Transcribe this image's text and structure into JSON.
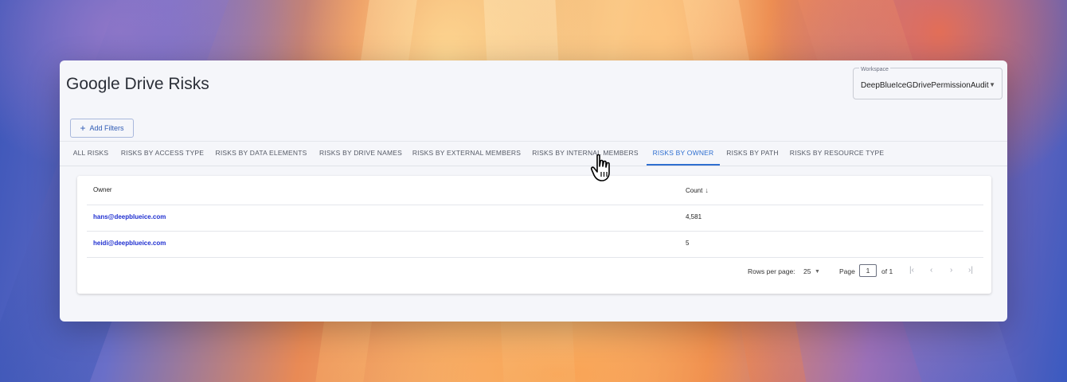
{
  "page": {
    "title": "Google Drive Risks"
  },
  "workspace": {
    "label": "Workspace",
    "value": "DeepBlueIceGDrivePermissionAudit"
  },
  "filters": {
    "add_label": "Add Filters"
  },
  "tabs": [
    {
      "label": "ALL RISKS",
      "active": false
    },
    {
      "label": "RISKS BY ACCESS TYPE",
      "active": false
    },
    {
      "label": "RISKS BY DATA ELEMENTS",
      "active": false
    },
    {
      "label": "RISKS BY DRIVE NAMES",
      "active": false
    },
    {
      "label": "RISKS BY EXTERNAL MEMBERS",
      "active": false
    },
    {
      "label": "RISKS BY INTERNAL MEMBERS",
      "active": false
    },
    {
      "label": "RISKS BY OWNER",
      "active": true
    },
    {
      "label": "RISKS BY PATH",
      "active": false
    },
    {
      "label": "RISKS BY RESOURCE TYPE",
      "active": false
    }
  ],
  "table": {
    "columns": [
      "Owner",
      "Count"
    ],
    "sort": {
      "column": "Count",
      "direction": "descending"
    },
    "rows": [
      {
        "owner": "hans@deepblueice.com",
        "count": "4,581"
      },
      {
        "owner": "heidi@deepblueice.com",
        "count": "5"
      }
    ]
  },
  "pagination": {
    "rows_per_page_label": "Rows per page:",
    "rows_per_page": "25",
    "page_label": "Page",
    "page": "1",
    "of_label": "of 1"
  },
  "colors": {
    "accent": "#2f6fd0",
    "link": "#1f2fd0"
  }
}
